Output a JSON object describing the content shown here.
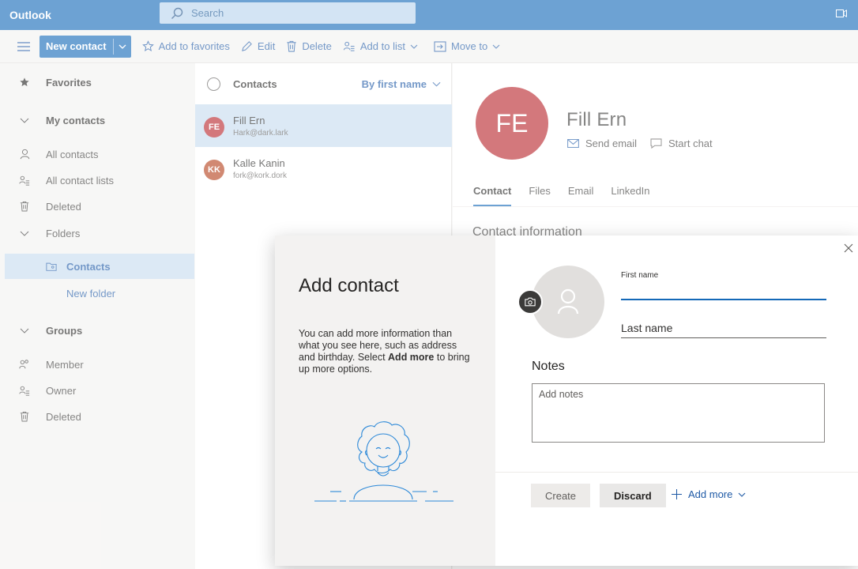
{
  "topbar": {
    "brand": "Outlook",
    "search_placeholder": "Search"
  },
  "toolbar": {
    "new_contact": "New contact",
    "add_to_favorites": "Add to favorites",
    "edit": "Edit",
    "delete": "Delete",
    "add_to_list": "Add to list",
    "move_to": "Move to"
  },
  "nav": {
    "favorites": "Favorites",
    "my_contacts": "My contacts",
    "all_contacts": "All contacts",
    "all_contact_lists": "All contact lists",
    "deleted": "Deleted",
    "folders": "Folders",
    "contacts": "Contacts",
    "new_folder": "New folder",
    "groups": "Groups",
    "member": "Member",
    "owner": "Owner",
    "groups_deleted": "Deleted"
  },
  "list": {
    "title": "Contacts",
    "sort": "By first name",
    "items": [
      {
        "initials": "FE",
        "name": "Fill Ern",
        "email": "Hark@dark.lark",
        "color": "#b8262d"
      },
      {
        "initials": "KK",
        "name": "Kalle Kanin",
        "email": "fork@kork.dork",
        "color": "#b5421c"
      }
    ]
  },
  "detail": {
    "initials": "FE",
    "name": "Fill Ern",
    "send_email": "Send email",
    "start_chat": "Start chat",
    "tabs": [
      "Contact",
      "Files",
      "Email",
      "LinkedIn"
    ],
    "section": "Contact information"
  },
  "modal": {
    "title": "Add contact",
    "desc_1": "You can add more information than what you see here, such as address and birthday. Select ",
    "desc_bold": "Add more",
    "desc_2": " to bring up more options.",
    "first_name_label": "First name",
    "first_name_value": "",
    "last_name_placeholder": "Last name",
    "notes_title": "Notes",
    "notes_placeholder": "Add notes",
    "create": "Create",
    "discard": "Discard",
    "add_more": "Add more"
  },
  "colors": {
    "accent": "#1469b8",
    "selection": "#c7dcef"
  }
}
